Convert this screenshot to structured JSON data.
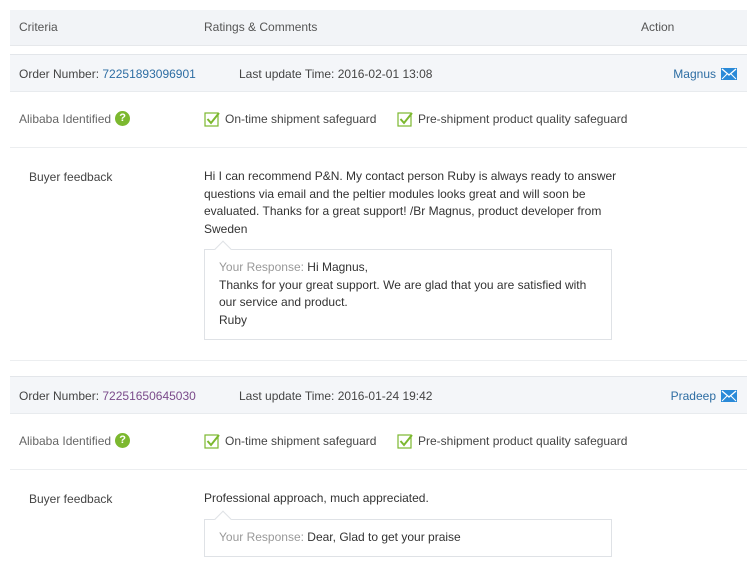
{
  "header": {
    "criteria": "Criteria",
    "ratings": "Ratings & Comments",
    "action": "Action"
  },
  "orders": [
    {
      "order_label": "Order Number:",
      "order_number": "72251893096901",
      "update_label": "Last update Time:",
      "update_time": "2016-02-01 13:08",
      "user": "Magnus",
      "identified_label": "Alibaba Identified",
      "safeguard_1": "On-time shipment safeguard",
      "safeguard_2": "Pre-shipment product quality safeguard",
      "feedback_label": "Buyer feedback",
      "feedback_lines": [
        "Hi I can recommend P&N. My contact person Ruby is always ready to answer",
        "questions via email and the peltier modules looks great and will soon be",
        "evaluated. Thanks for a great support! /Br Magnus, product developer from",
        "Sweden"
      ],
      "response_label": "Your Response:",
      "response_lines": [
        "Hi Magnus,",
        "Thanks for your great support. We are glad that you are satisfied with",
        "our service and product.",
        "Ruby"
      ]
    },
    {
      "order_label": "Order Number:",
      "order_number": "72251650645030",
      "update_label": "Last update Time:",
      "update_time": "2016-01-24 19:42",
      "user": "Pradeep",
      "identified_label": "Alibaba Identified",
      "safeguard_1": "On-time shipment safeguard",
      "safeguard_2": "Pre-shipment product quality safeguard",
      "feedback_label": "Buyer feedback",
      "feedback_lines": [
        "Professional approach, much appreciated."
      ],
      "response_label": "Your Response:",
      "response_lines": [
        "Dear, Glad to get your praise"
      ]
    }
  ],
  "icons": {
    "mail": "mail-icon",
    "question": "question-icon",
    "check": "checkbox-checked-icon"
  },
  "colors": {
    "link": "#2d6da3",
    "visited_link": "#7a4a8a",
    "green": "#7cb82f",
    "mail_blue": "#2a8ad8"
  }
}
